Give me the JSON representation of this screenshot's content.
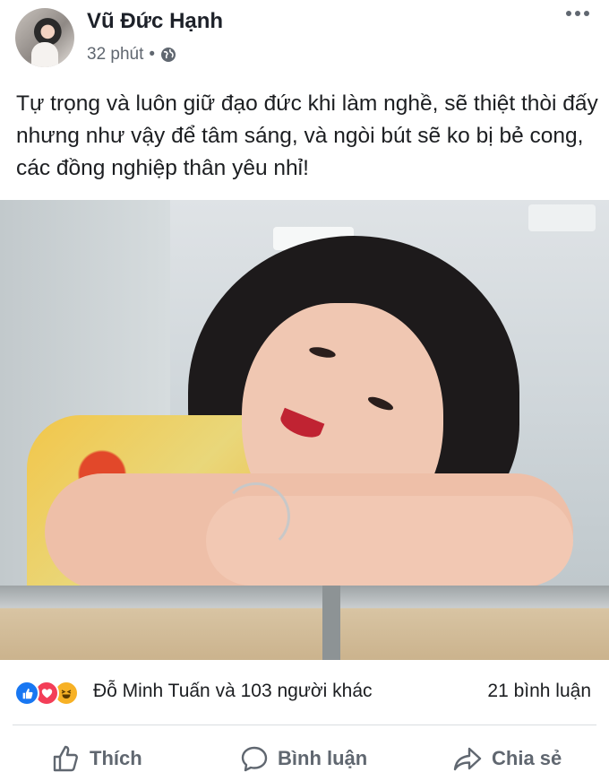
{
  "post": {
    "author": "Vũ Đức Hạnh",
    "time": "32 phút",
    "separator": "•",
    "privacy_icon": "globe-icon",
    "text": "Tự trọng và luôn giữ đạo đức khi làm nghề, sẽ thiệt thòi đấy nhưng như vậy để tâm sáng, và ngòi bút sẽ ko bị bẻ cong, các đồng nghiệp thân yêu nhỉ!"
  },
  "reactions": {
    "icons": [
      "like-icon",
      "love-icon",
      "haha-icon"
    ],
    "summary": "Đỗ Minh Tuấn và 103 người khác",
    "comments": "21 bình luận"
  },
  "actions": {
    "like": "Thích",
    "comment": "Bình luận",
    "share": "Chia sẻ"
  },
  "colors": {
    "like_blue": "#1877f2",
    "love_red": "#f33e58",
    "haha_yellow": "#f7b125",
    "secondary_text": "#606770"
  }
}
